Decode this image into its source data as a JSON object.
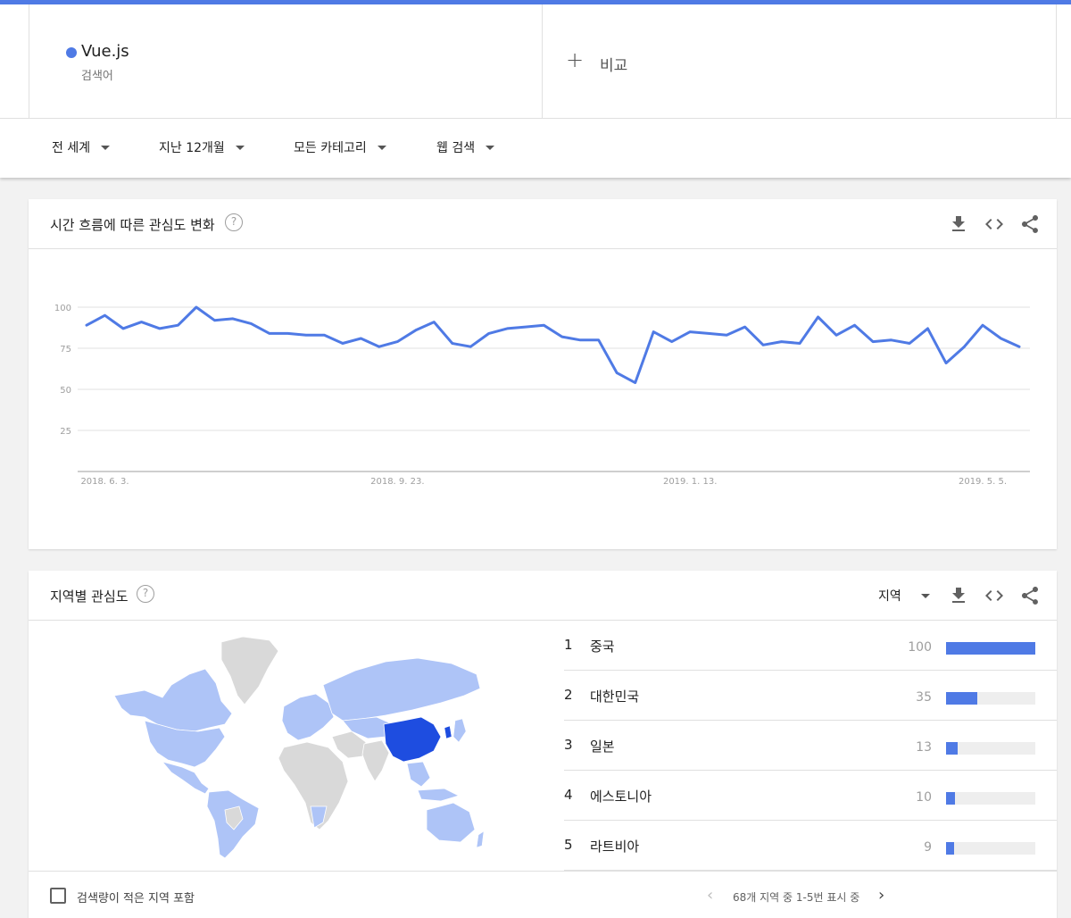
{
  "term": {
    "name": "Vue.js",
    "type": "검색어",
    "color": "#4f7ae5"
  },
  "compare": {
    "icon": "plus-icon",
    "label": "비교"
  },
  "filters": [
    {
      "label": "전 세계",
      "icon": "caret-down-icon"
    },
    {
      "label": "지난 12개월",
      "icon": "caret-down-icon"
    },
    {
      "label": "모든 카테고리",
      "icon": "caret-down-icon"
    },
    {
      "label": "웹 검색",
      "icon": "caret-down-icon"
    }
  ],
  "interest_over_time": {
    "title": "시간 흐름에 따른 관심도 변화",
    "help_icon": "help-icon",
    "tools": [
      "download-icon",
      "embed-code-icon",
      "share-icon"
    ]
  },
  "chart_data": {
    "type": "line",
    "title": "",
    "xlabel": "",
    "ylabel": "",
    "ylim": [
      0,
      100
    ],
    "yticks": [
      25,
      50,
      75,
      100
    ],
    "xtick_labels": [
      "2018. 6. 3.",
      "2018. 9. 23.",
      "2019. 1. 13.",
      "2019. 5. 5."
    ],
    "x": [
      "2018-05-27",
      "2018-06-03",
      "2018-06-10",
      "2018-06-17",
      "2018-06-24",
      "2018-07-01",
      "2018-07-08",
      "2018-07-15",
      "2018-07-22",
      "2018-07-29",
      "2018-08-05",
      "2018-08-12",
      "2018-08-19",
      "2018-08-26",
      "2018-09-02",
      "2018-09-09",
      "2018-09-16",
      "2018-09-23",
      "2018-09-30",
      "2018-10-07",
      "2018-10-14",
      "2018-10-21",
      "2018-10-28",
      "2018-11-04",
      "2018-11-11",
      "2018-11-18",
      "2018-11-25",
      "2018-12-02",
      "2018-12-09",
      "2018-12-16",
      "2018-12-23",
      "2018-12-30",
      "2019-01-06",
      "2019-01-13",
      "2019-01-20",
      "2019-01-27",
      "2019-02-03",
      "2019-02-10",
      "2019-02-17",
      "2019-02-24",
      "2019-03-03",
      "2019-03-10",
      "2019-03-17",
      "2019-03-24",
      "2019-03-31",
      "2019-04-07",
      "2019-04-14",
      "2019-04-21",
      "2019-04-28",
      "2019-05-05",
      "2019-05-12",
      "2019-05-19"
    ],
    "series": [
      {
        "color": "#4f7ae5",
        "values": [
          89,
          95,
          87,
          91,
          87,
          89,
          100,
          92,
          93,
          90,
          84,
          84,
          83,
          83,
          78,
          81,
          76,
          79,
          86,
          91,
          78,
          76,
          84,
          87,
          88,
          89,
          82,
          80,
          80,
          60,
          54,
          85,
          79,
          85,
          84,
          83,
          88,
          77,
          79,
          78,
          94,
          83,
          89,
          79,
          80,
          78,
          87,
          66,
          76,
          89,
          81,
          76
        ]
      }
    ],
    "grid": true
  },
  "interest_by_region": {
    "title": "지역별 관심도",
    "help_icon": "help-icon",
    "resolution_label": "지역",
    "tools": [
      "download-icon",
      "embed-code-icon",
      "share-icon"
    ],
    "rows": [
      {
        "rank": "1",
        "name": "중국",
        "value": 100
      },
      {
        "rank": "2",
        "name": "대한민국",
        "value": 35
      },
      {
        "rank": "3",
        "name": "일본",
        "value": 13
      },
      {
        "rank": "4",
        "name": "에스토니아",
        "value": 10
      },
      {
        "rank": "5",
        "name": "라트비아",
        "value": 9
      }
    ],
    "map_colors": {
      "none": "#d9d9d9",
      "low": "#aec4f7",
      "high": "#1e4de0"
    },
    "include_low_volume_label": "검색량이 적은 지역 포함",
    "pager_text": "68개 지역 중 1-5번 표시 중",
    "prev_icon": "chevron-left-icon",
    "next_icon": "chevron-right-icon"
  }
}
